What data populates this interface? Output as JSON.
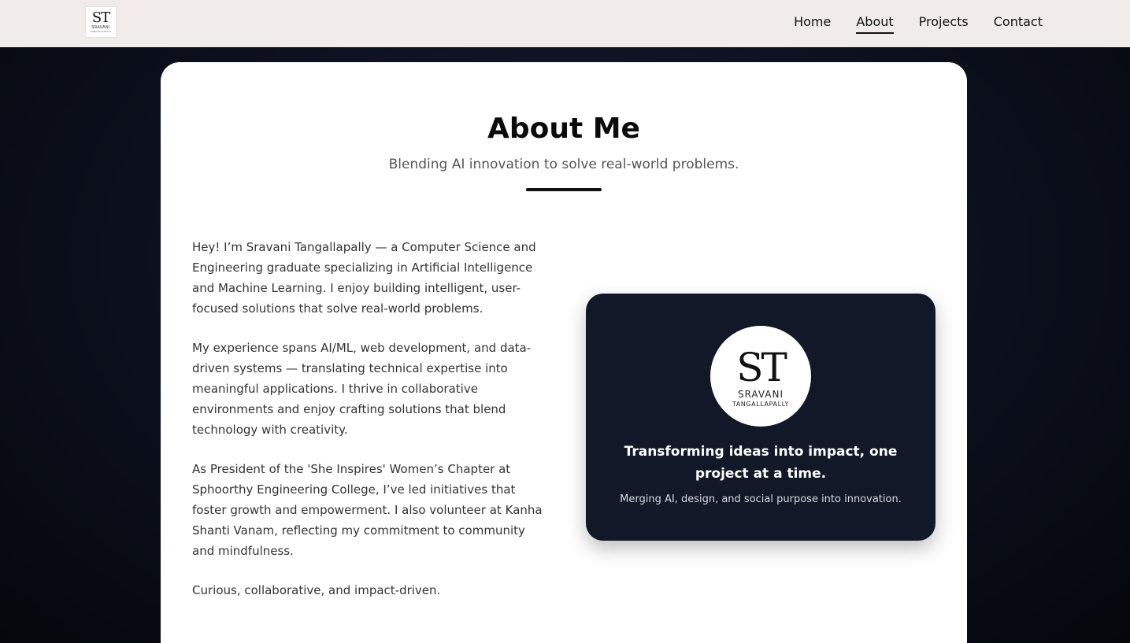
{
  "brand": {
    "logo_mark": "ST",
    "logo_first": "SRAVANI",
    "logo_last": "TANGALLAPALLY"
  },
  "nav": {
    "items": [
      "Home",
      "About",
      "Projects",
      "Contact"
    ],
    "active": "About"
  },
  "about": {
    "title": "About Me",
    "subtitle": "Blending AI innovation to solve real-world problems.",
    "paragraphs": [
      "Hey! I’m Sravani Tangallapally — a Computer Science and Engineering graduate specializing in Artificial Intelligence and Machine Learning. I enjoy building intelligent, user-focused solutions that solve real-world problems.",
      "My experience spans AI/ML, web development, and data-driven systems — translating technical expertise into meaningful applications. I thrive in collaborative environments and enjoy crafting solutions that blend technology with creativity.",
      "As President of the 'She Inspires' Women’s Chapter at Sphoorthy Engineering College, I’ve led initiatives that foster growth and empowerment. I also volunteer at Kanha Shanti Vanam, reflecting my commitment to community and mindfulness.",
      "Curious, collaborative, and impact-driven."
    ]
  },
  "feature_card": {
    "avatar_mark": "ST",
    "avatar_first": "SRAVANI",
    "avatar_last": "TANGALLAPALLY",
    "tagline": "Transforming ideas into impact, one project at a time.",
    "subtext": "Merging AI, design, and social purpose into innovation."
  },
  "colors": {
    "nav_bg": "#f1ece9",
    "page_bg": "#0d1220",
    "card_bg": "#ffffff",
    "feature_bg": "#111827",
    "accent": "#111111"
  }
}
